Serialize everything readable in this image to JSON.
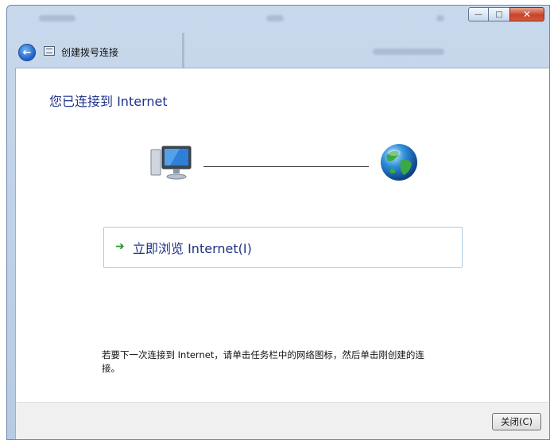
{
  "window": {
    "nav_title": "创建拨号连接",
    "controls": {
      "minimize": "—",
      "maximize": "□",
      "close": "✕"
    }
  },
  "content": {
    "heading": "您已连接到 Internet",
    "browse_link": "立即浏览 Internet(I)",
    "hint": "若要下一次连接到 Internet，请单击任务栏中的网络图标，然后单击刚创建的连接。"
  },
  "footer": {
    "close_button": "关闭(C)"
  },
  "colors": {
    "heading": "#1e3287",
    "link_border": "#a9cde6",
    "arrow": "#1f9d2a"
  },
  "icons": {
    "computer": "computer-icon",
    "globe": "globe-icon",
    "back": "back-arrow-icon",
    "link_arrow": "green-arrow-icon"
  }
}
